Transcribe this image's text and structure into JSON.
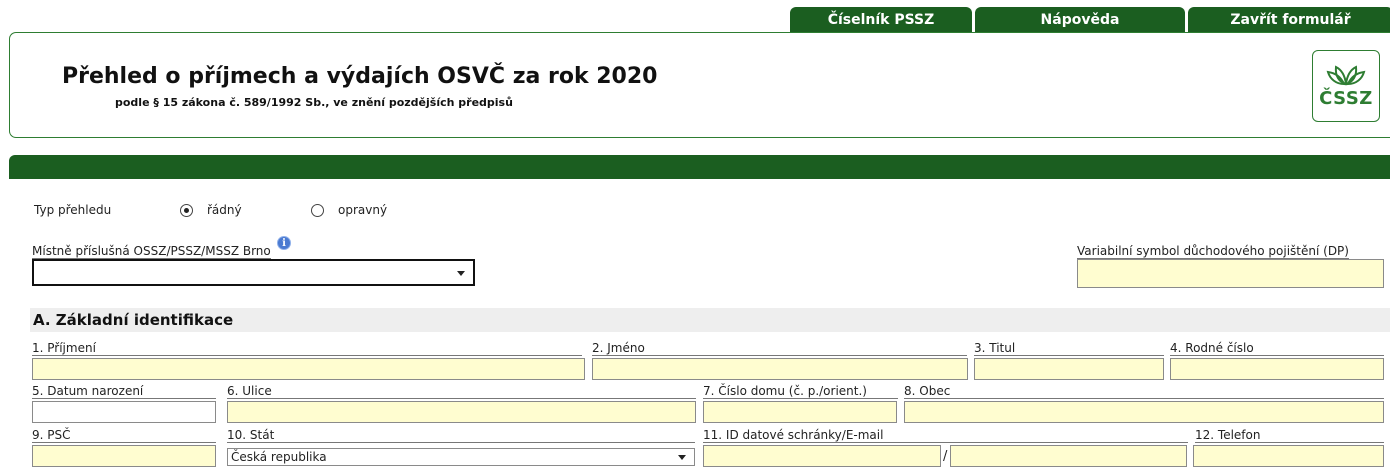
{
  "tabs": [
    "Číselník PSSZ",
    "Nápověda",
    "Zavřít formulář"
  ],
  "header": {
    "title": "Přehled o příjmech a výdajích OSVČ za rok 2020",
    "subtitle": "podle § 15 zákona č. 589/1992 Sb., ve znění pozdějších předpisů",
    "logo_text": "ČSSZ"
  },
  "form": {
    "typ_label": "Typ přehledu",
    "radio_radny": "řádný",
    "radio_opravny": "opravný",
    "selected_typ": "řádný",
    "ossz_label": "Místně příslušná OSSZ/PSSZ/MSSZ Brno",
    "ossz_value": "",
    "vs_label": "Variabilní symbol důchodového pojištění (DP)",
    "vs_value": ""
  },
  "section_a": {
    "title": "A. Základní identifikace",
    "fields": {
      "prijmeni": "1. Příjmení",
      "jmeno": "2. Jméno",
      "titul": "3. Titul",
      "rodne_cislo": "4. Rodné číslo",
      "datum_narozeni": "5. Datum narození",
      "ulice": "6. Ulice",
      "cislo_domu": "7. Číslo domu (č. p./orient.)",
      "obec": "8. Obec",
      "psc": "9. PSČ",
      "stat": "10. Stát",
      "stat_value": "Česká republika",
      "id_schranky": "11. ID datové schránky/E-mail",
      "telefon": "12. Telefon"
    }
  },
  "colors": {
    "brand_green": "#1b5e20",
    "field_yellow": "#fffdd0"
  },
  "icons": [
    "leaf-logo-icon",
    "info-icon",
    "chevron-down-icon"
  ]
}
